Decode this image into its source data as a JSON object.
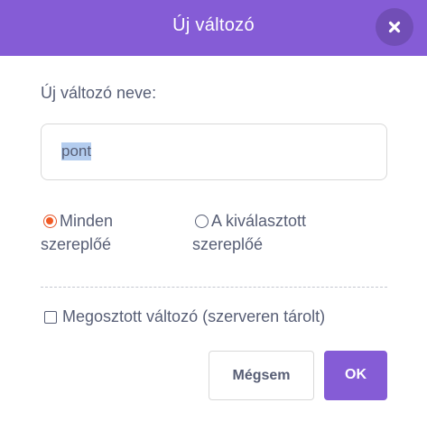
{
  "dialog": {
    "title": "Új változó",
    "close_icon": "close-icon"
  },
  "form": {
    "name_label": "Új változó neve:",
    "name_value": "pont",
    "scope_options": [
      {
        "line1": "Minden",
        "line2": "szereplőé",
        "selected": true
      },
      {
        "line1": "A kiválasztott",
        "line2": "szereplőé",
        "selected": false
      }
    ],
    "cloud_checkbox_label": "Megosztott változó (szerveren tárolt)",
    "cloud_checked": false
  },
  "buttons": {
    "cancel_label": "Mégsem",
    "ok_label": "OK"
  },
  "colors": {
    "header": "#855cd6",
    "text": "#575e75",
    "radio_selected": "#f15a24"
  }
}
